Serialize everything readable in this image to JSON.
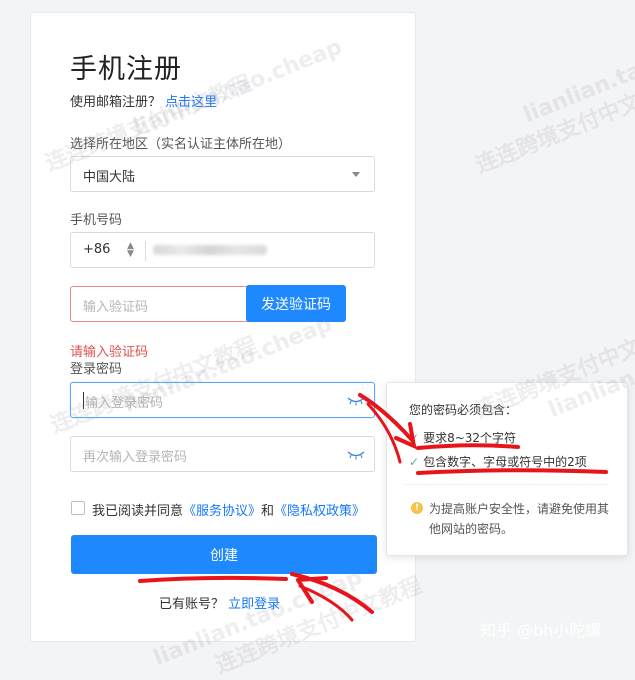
{
  "title": "手机注册",
  "email_prompt": "使用邮箱注册？",
  "email_link": "点击这里",
  "region": {
    "label": "选择所在地区（实名认证主体所在地）",
    "value": "中国大陆"
  },
  "phone": {
    "label": "手机号码",
    "prefix": "+86"
  },
  "code": {
    "placeholder": "输入验证码",
    "send_button": "发送验证码",
    "error": "请输入验证码"
  },
  "password": {
    "label": "登录密码",
    "placeholder": "输入登录密码",
    "confirm_placeholder": "再次输入登录密码"
  },
  "agreement": {
    "text": "我已阅读并同意",
    "service": "《服务协议》",
    "and": "和",
    "privacy": "《隐私权政策》"
  },
  "create_button": "创建",
  "login_prompt": "已有账号？",
  "login_link": "立即登录",
  "tooltip": {
    "title": "您的密码必须包含：",
    "rules": [
      "要求8~32个字符",
      "包含数字、字母或符号中的2项"
    ],
    "warning": "为提高账户安全性，请避免使用其他网站的密码。"
  },
  "watermarks": [
    "连连跨境支付中文教程",
    "lianlian.tao.cheap"
  ],
  "credit": "知乎 @bh小陀螺",
  "colors": {
    "primary": "#1e88ff",
    "error": "#e05050",
    "annotation": "#e8141b"
  }
}
